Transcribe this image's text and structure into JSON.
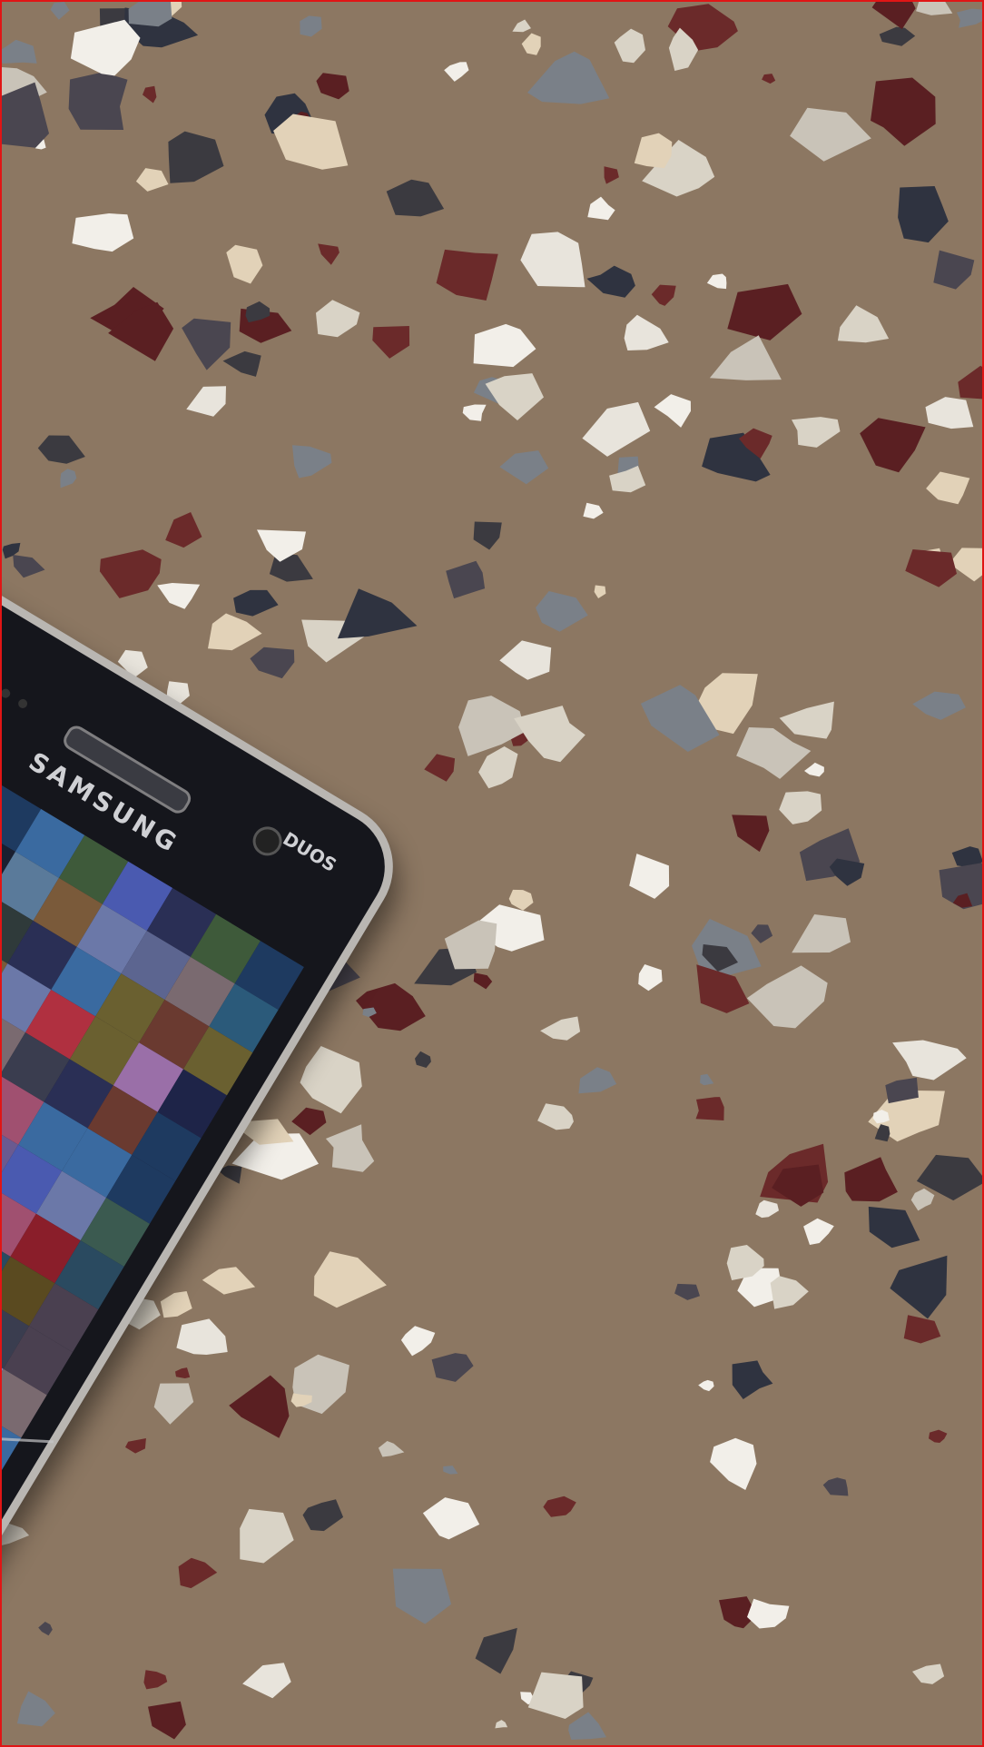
{
  "scene": {
    "floor_color": "#8a7560",
    "border_color": "#e01515"
  },
  "phone": {
    "brand_text": "SAMSUNG",
    "badge_text": "DUOS",
    "back_key_icon": "back-arrow-icon",
    "recent_key_icon": "recent-apps-icon",
    "body_color": "#15161c",
    "home_button_color": "#c9a996",
    "screen_state": "pixelated"
  }
}
